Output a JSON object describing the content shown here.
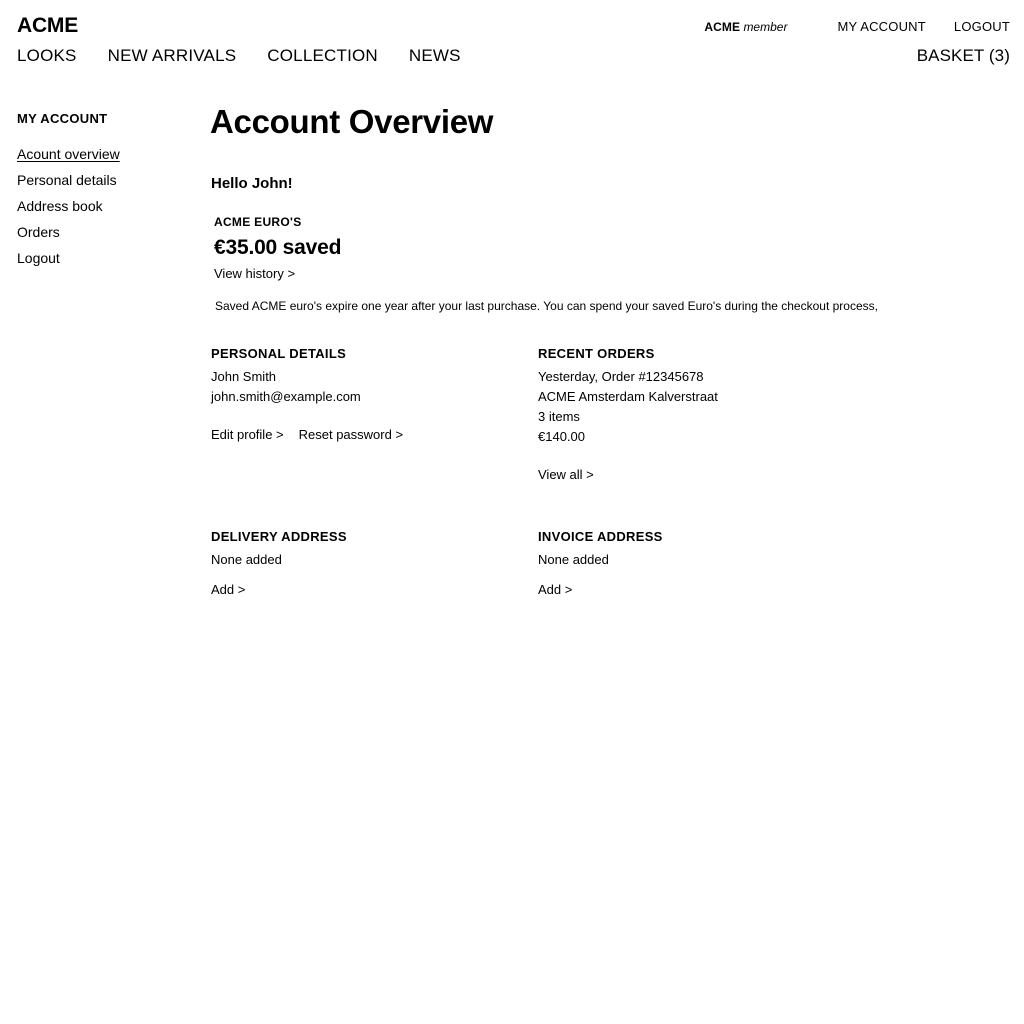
{
  "header": {
    "brand": "ACME",
    "member_badge": {
      "brand": "ACME",
      "word": "member"
    },
    "account_link": "MY ACCOUNT",
    "logout_link": "LOGOUT",
    "basket_link": "BASKET (3)",
    "nav": [
      {
        "label": "LOOKS"
      },
      {
        "label": "NEW ARRIVALS"
      },
      {
        "label": "COLLECTION"
      },
      {
        "label": "NEWS"
      }
    ]
  },
  "sidebar": {
    "title": "MY ACCOUNT",
    "items": [
      {
        "label": "Acount overview",
        "active": true
      },
      {
        "label": "Personal details",
        "active": false
      },
      {
        "label": "Address book",
        "active": false
      },
      {
        "label": "Orders",
        "active": false
      },
      {
        "label": "Logout",
        "active": false
      }
    ]
  },
  "main": {
    "page_title": "Account Overview",
    "greeting": "Hello John!",
    "euro": {
      "label": "ACME EURO'S",
      "amount": "€35.00 saved",
      "history_link": "View history >",
      "disclaimer": "Saved ACME euro's expire one year after your last purchase. You can spend your saved Euro's during the checkout process,"
    },
    "personal_details": {
      "heading": "PERSONAL DETAILS",
      "name": "John Smith",
      "email": "john.smith@example.com",
      "edit_link": "Edit profile >",
      "reset_link": "Reset password >"
    },
    "recent_orders": {
      "heading": "RECENT ORDERS",
      "order_line": "Yesterday, Order #12345678",
      "store_line": "ACME Amsterdam Kalverstraat",
      "items_line": "3 items",
      "total_line": "€140.00",
      "view_all_link": "View all >"
    },
    "delivery_address": {
      "heading": "DELIVERY ADDRESS",
      "value": "None added",
      "add_link": "Add >"
    },
    "invoice_address": {
      "heading": "INVOICE ADDRESS",
      "value": "None added",
      "add_link": "Add >"
    }
  },
  "colors": {
    "background": "#ffffff",
    "text": "#000000"
  }
}
